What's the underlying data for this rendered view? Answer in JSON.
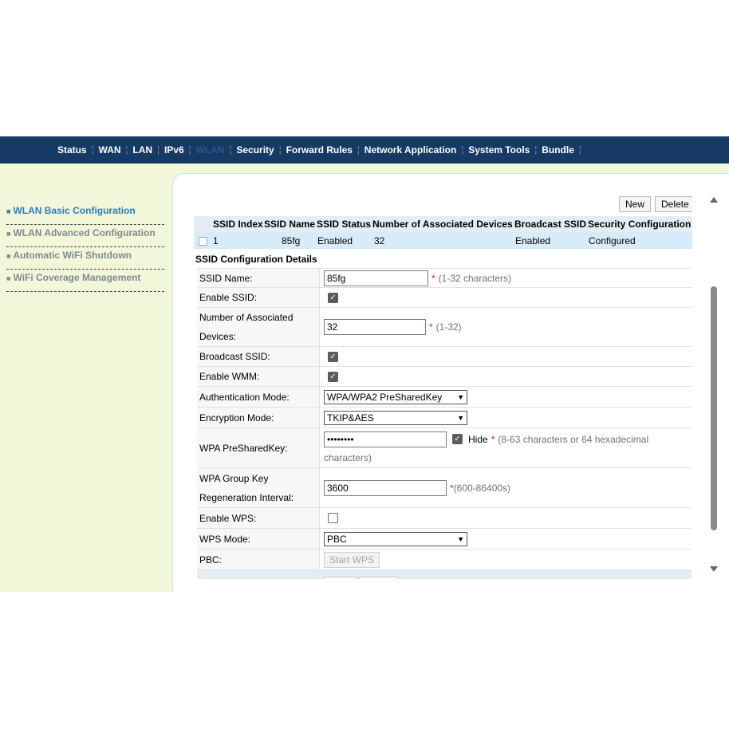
{
  "nav": [
    {
      "label": "Status"
    },
    {
      "label": "WAN"
    },
    {
      "label": "LAN"
    },
    {
      "label": "IPv6"
    },
    {
      "label": "WLAN",
      "active": true
    },
    {
      "label": "Security"
    },
    {
      "label": "Forward Rules"
    },
    {
      "label": "Network Application"
    },
    {
      "label": "System Tools"
    },
    {
      "label": "Bundle"
    }
  ],
  "nav_separator": "¦",
  "sidebar": {
    "bullet": "■",
    "items": [
      {
        "label": "WLAN Basic Configuration",
        "active": true
      },
      {
        "label": "WLAN Advanced Configuration"
      },
      {
        "label": "Automatic WiFi Shutdown"
      },
      {
        "label": "WiFi Coverage Management"
      }
    ]
  },
  "toolbar": {
    "new_label": "New",
    "delete_label": "Delete"
  },
  "ssid_table": {
    "headers": [
      "SSID Index",
      "SSID Name",
      "SSID Status",
      "Number of Associated Devices",
      "Broadcast SSID",
      "Security Configuration"
    ],
    "rows": [
      {
        "index": "1",
        "name": "85fg",
        "status": "Enabled",
        "devices": "32",
        "broadcast": "Enabled",
        "security": "Configured"
      }
    ]
  },
  "details": {
    "title": "SSID Configuration Details",
    "ssid_name": {
      "label": "SSID Name:",
      "value": "85fg",
      "req": "*",
      "hint": "(1-32 characters)"
    },
    "enable_ssid": {
      "label": "Enable SSID:",
      "checked": true
    },
    "associated": {
      "label1": "Number of Associated",
      "label2": "Devices:",
      "value": "32",
      "req": "*",
      "hint": "(1-32)"
    },
    "broadcast": {
      "label": "Broadcast SSID:",
      "checked": true
    },
    "wmm": {
      "label": "Enable WMM:",
      "checked": true
    },
    "auth": {
      "label": "Authentication Mode:",
      "value": "WPA/WPA2 PreSharedKey"
    },
    "encryption": {
      "label": "Encryption Mode:",
      "value": "TKIP&AES"
    },
    "psk": {
      "label": "WPA PreSharedKey:",
      "value": "••••••••",
      "hide_label": "Hide",
      "req": "*",
      "hint1": "(8-63 characters or 64 hexadecimal",
      "hint2": "characters)"
    },
    "group_key": {
      "label1": "WPA Group Key",
      "label2": "Regeneration Interval:",
      "value": "3600",
      "req": "*",
      "hint": "(600-86400s)"
    },
    "wps": {
      "label": "Enable WPS:",
      "checked": false
    },
    "wps_mode": {
      "label": "WPS Mode:",
      "value": "PBC"
    },
    "pbc": {
      "label": "PBC:",
      "button": "Start WPS"
    }
  },
  "check_glyph": "✓",
  "caret_glyph": "▼"
}
